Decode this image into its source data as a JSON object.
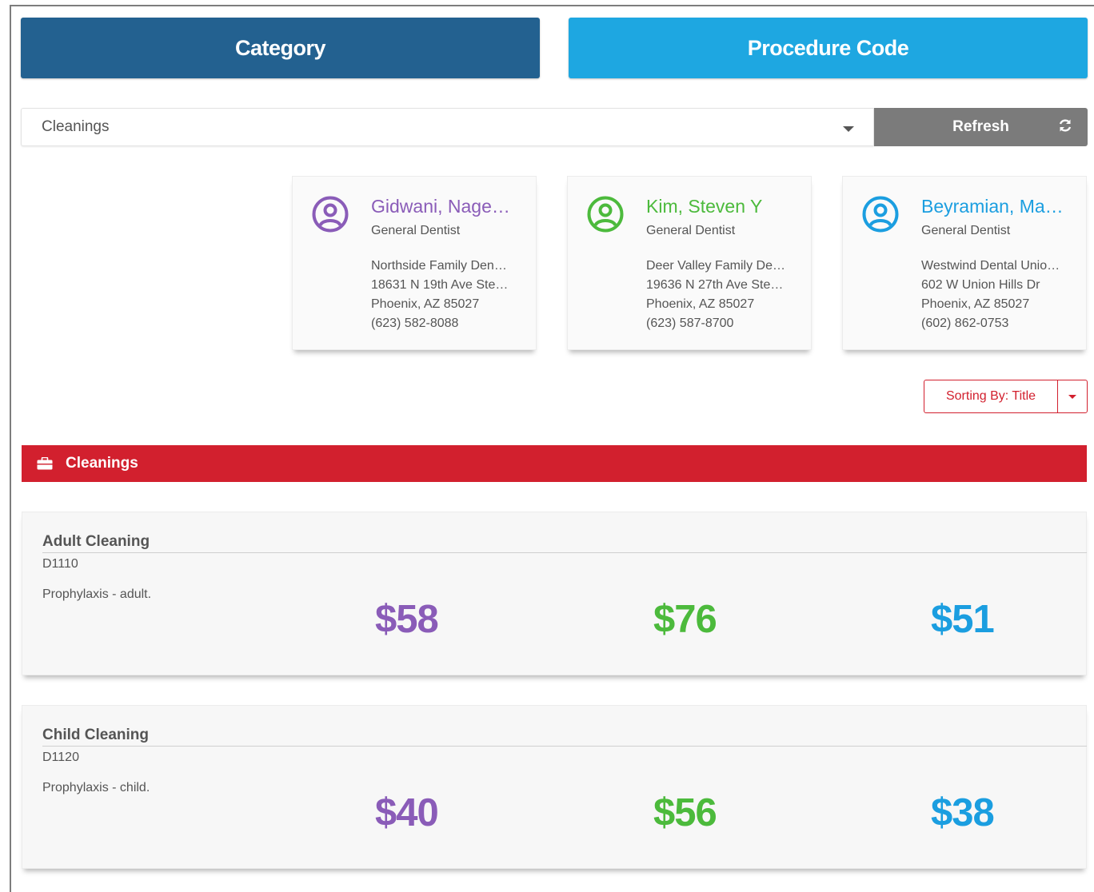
{
  "tabs": {
    "category_label": "Category",
    "procedure_label": "Procedure Code"
  },
  "filter": {
    "selected": "Cleanings",
    "refresh_label": "Refresh"
  },
  "providers": [
    {
      "name": "Gidwani, Nage…",
      "type": "General Dentist",
      "address": [
        "Northside Family Den…",
        "18631 N 19th Ave Ste…",
        "Phoenix, AZ 85027",
        "(623) 582-8088"
      ],
      "color": "#8a5cb8"
    },
    {
      "name": "Kim, Steven Y",
      "type": "General Dentist",
      "address": [
        "Deer Valley Family De…",
        "19636 N 27th Ave Ste…",
        "Phoenix, AZ 85027",
        "(623) 587-8700"
      ],
      "color": "#4cba3c"
    },
    {
      "name": "Beyramian, Ma…",
      "type": "General Dentist",
      "address": [
        "Westwind Dental Unio…",
        "602 W Union Hills Dr",
        "Phoenix, AZ 85027",
        "(602) 862-0753"
      ],
      "color": "#1b9ee0"
    }
  ],
  "sort": {
    "label": "Sorting By: Title"
  },
  "section": {
    "title": "Cleanings",
    "icon": "briefcase-icon",
    "color": "#d2202e"
  },
  "procedures": [
    {
      "title": "Adult Cleaning",
      "code": "D1110",
      "description": "Prophylaxis - adult.",
      "prices": [
        "$58",
        "$76",
        "$51"
      ]
    },
    {
      "title": "Child Cleaning",
      "code": "D1120",
      "description": "Prophylaxis - child.",
      "prices": [
        "$40",
        "$56",
        "$38"
      ]
    }
  ]
}
